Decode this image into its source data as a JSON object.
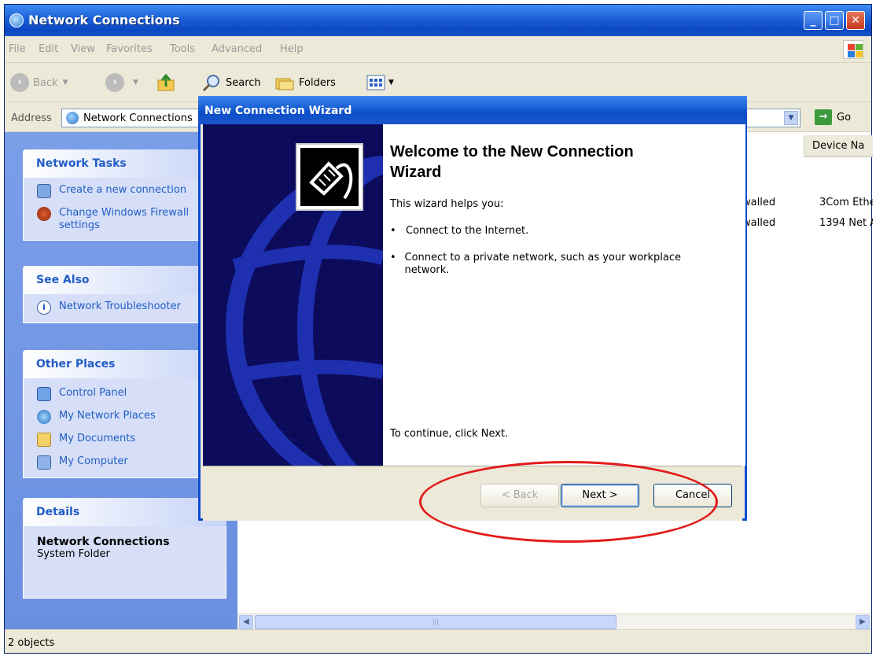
{
  "window": {
    "title": "Network Connections",
    "controls": [
      "minimize",
      "maximize",
      "close"
    ]
  },
  "menu": [
    "File",
    "Edit",
    "View",
    "Favorites",
    "Tools",
    "Advanced",
    "Help"
  ],
  "toolbar": {
    "back": "Back",
    "search": "Search",
    "folders": "Folders"
  },
  "address": {
    "label": "Address",
    "value": "Network Connections",
    "go": "Go"
  },
  "sidebar": {
    "network_tasks": {
      "title": "Network Tasks",
      "items": [
        "Create a new connection",
        "Change Windows Firewall settings"
      ]
    },
    "see_also": {
      "title": "See Also",
      "items": [
        "Network Troubleshooter"
      ]
    },
    "other_places": {
      "title": "Other Places",
      "items": [
        "Control Panel",
        "My Network Places",
        "My Documents",
        "My Computer"
      ]
    },
    "details": {
      "title": "Details",
      "name": "Network Connections",
      "type": "System Folder"
    }
  },
  "list": {
    "column": "Device Na",
    "rows": [
      {
        "status": "walled",
        "device": "3Com Ethe"
      },
      {
        "status": "walled",
        "device": "1394 Net A"
      }
    ]
  },
  "status": "2 objects",
  "wizard": {
    "title": "New Connection Wizard",
    "heading": "Welcome to the New Connection Wizard",
    "intro": "This wizard helps you:",
    "bullets": [
      "Connect to the Internet.",
      "Connect to a private network, such as your workplace network."
    ],
    "continue": "To continue, click Next.",
    "buttons": {
      "back": "< Back",
      "next": "Next >",
      "cancel": "Cancel"
    }
  },
  "colors": {
    "title_blue": "#0b47c2",
    "task_link": "#215dc6",
    "highlight": "#e31b1b"
  }
}
